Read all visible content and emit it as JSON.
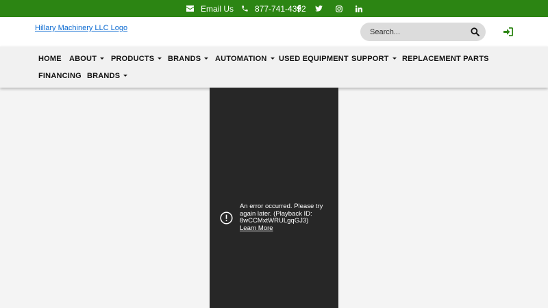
{
  "topbar": {
    "email_label": "Email Us",
    "phone_label": "877-741-4392",
    "social_icons": [
      "facebook-icon",
      "twitter-icon",
      "instagram-icon",
      "linkedin-icon"
    ],
    "background_color": "#2c8513"
  },
  "header": {
    "logo_alt": "Hillary Machinery LLC Logo",
    "search": {
      "placeholder": "Search..."
    },
    "login_icon": "sign-in-icon",
    "accent_color": "#2c8513"
  },
  "nav": {
    "items": [
      {
        "label": "HOME",
        "dropdown": false
      },
      {
        "label": "ABOUT",
        "dropdown": true
      },
      {
        "label": "PRODUCTS",
        "dropdown": true
      },
      {
        "label": "BRANDS",
        "dropdown": true
      },
      {
        "label": "AUTOMATION",
        "dropdown": true
      },
      {
        "label": "USED EQUIPMENT",
        "dropdown": false
      },
      {
        "label": "SUPPORT",
        "dropdown": true
      },
      {
        "label": "REPLACEMENT PARTS",
        "dropdown": false
      },
      {
        "label": "FINANCING",
        "dropdown": false
      },
      {
        "label": "BRANDS",
        "dropdown": true
      }
    ]
  },
  "video": {
    "error_message": "An error occurred. Please try again later. (Playback ID: 8wCCMxtWRULgqGJ3)",
    "learn_more": "Learn More"
  }
}
